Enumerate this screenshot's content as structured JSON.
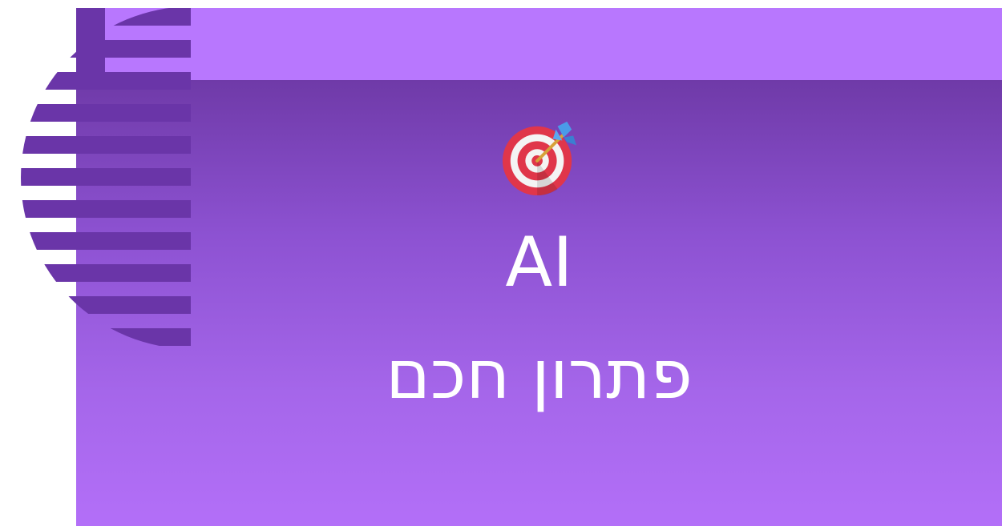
{
  "slide": {
    "title": "AI",
    "subtitle": "פתרון חכם",
    "icon": "target-dart-icon"
  },
  "colors": {
    "top_band": "#b877fe",
    "panel_top": "#6f3aa8",
    "panel_bottom": "#b36ff8",
    "stripes": "#6a35a8",
    "text": "#ffffff",
    "target_red": "#e0364a",
    "dart_blue": "#4a9be8"
  }
}
